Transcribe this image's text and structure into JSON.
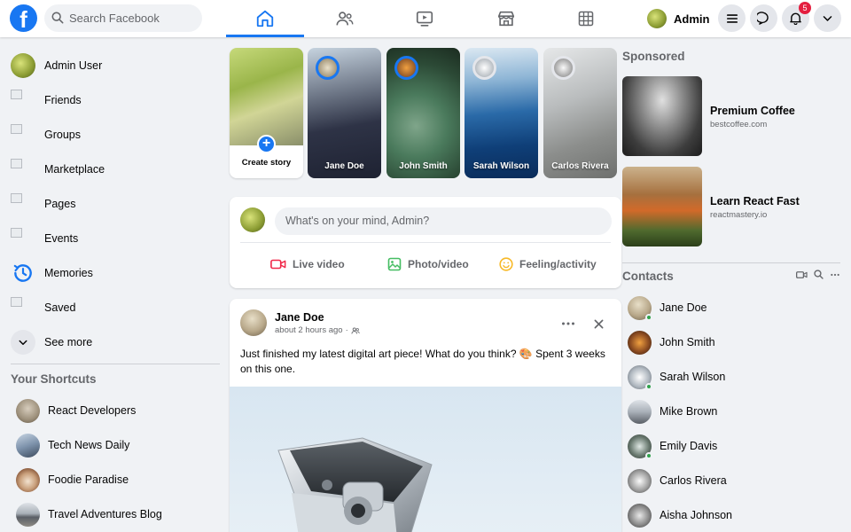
{
  "header": {
    "logo": "f",
    "search_placeholder": "Search Facebook",
    "profile_name": "Admin",
    "notification_count": "5",
    "tabs": [
      {
        "name": "home",
        "active": true
      },
      {
        "name": "friends",
        "active": false
      },
      {
        "name": "watch",
        "active": false
      },
      {
        "name": "marketplace",
        "active": false
      },
      {
        "name": "gaming",
        "active": false
      }
    ]
  },
  "sidebar": {
    "items": [
      {
        "label": "Admin User",
        "icon": "avatar"
      },
      {
        "label": "Friends",
        "icon": "friends-icon"
      },
      {
        "label": "Groups",
        "icon": "groups-icon"
      },
      {
        "label": "Marketplace",
        "icon": "marketplace-icon"
      },
      {
        "label": "Pages",
        "icon": "pages-icon"
      },
      {
        "label": "Events",
        "icon": "events-icon"
      },
      {
        "label": "Memories",
        "icon": "memories-icon"
      },
      {
        "label": "Saved",
        "icon": "saved-icon"
      },
      {
        "label": "See more",
        "icon": "chevron-down-icon"
      }
    ],
    "shortcuts_title": "Your Shortcuts",
    "shortcuts": [
      {
        "label": "React Developers"
      },
      {
        "label": "Tech News Daily"
      },
      {
        "label": "Foodie Paradise"
      },
      {
        "label": "Travel Adventures Blog"
      }
    ]
  },
  "stories": {
    "create_label": "Create story",
    "items": [
      {
        "name": "Jane Doe"
      },
      {
        "name": "John Smith"
      },
      {
        "name": "Sarah Wilson"
      },
      {
        "name": "Carlos Rivera"
      }
    ]
  },
  "composer": {
    "placeholder": "What's on your mind, Admin?",
    "actions": [
      {
        "label": "Live video",
        "icon": "video-camera-icon",
        "color": "#f02849"
      },
      {
        "label": "Photo/video",
        "icon": "photo-icon",
        "color": "#45bd62"
      },
      {
        "label": "Feeling/activity",
        "icon": "smiley-icon",
        "color": "#f7b928"
      }
    ]
  },
  "post": {
    "author": "Jane Doe",
    "time": "about 2 hours ago",
    "separator": "·",
    "text": "Just finished my latest digital art piece! What do you think? 🎨 Spent 3 weeks on this one."
  },
  "right": {
    "sponsored_title": "Sponsored",
    "ads": [
      {
        "title": "Premium Coffee",
        "url": "bestcoffee.com"
      },
      {
        "title": "Learn React Fast",
        "url": "reactmastery.io"
      }
    ],
    "contacts_title": "Contacts",
    "contacts": [
      {
        "name": "Jane Doe",
        "online": true
      },
      {
        "name": "John Smith",
        "online": false
      },
      {
        "name": "Sarah Wilson",
        "online": true
      },
      {
        "name": "Mike Brown",
        "online": false
      },
      {
        "name": "Emily Davis",
        "online": true
      },
      {
        "name": "Carlos Rivera",
        "online": false
      },
      {
        "name": "Aisha Johnson",
        "online": false
      }
    ]
  },
  "colors": {
    "brand": "#1877f2",
    "background": "#f0f2f5",
    "online": "#31a24c",
    "badge": "#e41e3f"
  }
}
